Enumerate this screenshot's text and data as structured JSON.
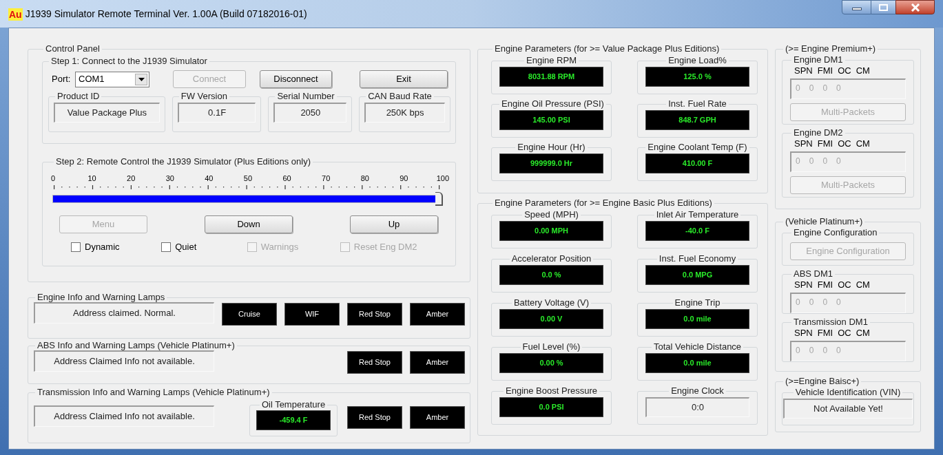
{
  "window": {
    "app_icon": "Au",
    "title": "J1939 Simulator Remote Terminal Ver. 1.00A (Build 07182016-01)"
  },
  "control_panel": {
    "title": "Control Panel",
    "step1": {
      "title": "Step 1: Connect to the J1939 Simulator",
      "port_label": "Port:",
      "port_value": "COM1",
      "buttons": [
        {
          "label": "Connect",
          "disabled": true
        },
        {
          "label": "Disconnect",
          "disabled": false
        },
        {
          "label": "Exit",
          "disabled": false
        }
      ],
      "info": [
        {
          "title": "Product ID",
          "value": "Value Package Plus"
        },
        {
          "title": "FW Version",
          "value": "0.1F"
        },
        {
          "title": "Serial Number",
          "value": "2050"
        },
        {
          "title": "CAN Baud Rate",
          "value": "250K bps"
        }
      ]
    },
    "step2": {
      "title": "Step 2: Remote Control the J1939 Simulator (Plus Editions only)",
      "scale": [
        "0",
        "10",
        "20",
        "30",
        "40",
        "50",
        "60",
        "70",
        "80",
        "90",
        "100"
      ],
      "slider": {
        "level": 1
      },
      "buttons": [
        {
          "label": "Menu",
          "disabled": true
        },
        {
          "label": "Down",
          "disabled": false
        },
        {
          "label": "Up",
          "disabled": false
        }
      ],
      "checkboxes": [
        {
          "label": "Dynamic",
          "checked": false,
          "disabled": false
        },
        {
          "label": "Quiet",
          "checked": false,
          "disabled": false
        },
        {
          "label": "Warnings",
          "checked": false,
          "disabled": true
        },
        {
          "label": "Reset Eng DM2",
          "checked": false,
          "disabled": true
        }
      ]
    }
  },
  "lamp_groups": [
    {
      "title": "Engine Info and Warning Lamps",
      "status": "Address claimed. Normal.",
      "lamps": [
        "Cruise",
        "WIF",
        "Red Stop",
        "Amber"
      ]
    },
    {
      "title": "ABS Info and Warning Lamps (Vehicle Platinum+)",
      "status": "Address Claimed Info not available.",
      "lamps": [
        "Red Stop",
        "Amber"
      ]
    },
    {
      "title": "Transmission Info and Warning Lamps (Vehicle Platinum+)",
      "status": "Address Claimed Info not available.",
      "gauge": {
        "title": "Oil Temperature",
        "value": "-459.4 F"
      },
      "lamps": [
        "Red Stop",
        "Amber"
      ]
    }
  ],
  "value_package_parameters": {
    "title": "Engine Parameters (for >= Value Package Plus Editions)",
    "gauges": [
      {
        "label": "Engine RPM",
        "value": "8031.88 RPM",
        "kind": "display"
      },
      {
        "label": "Engine Load%",
        "value": "125.0 %",
        "kind": "display"
      },
      {
        "label": "Engine Oil Pressure (PSI)",
        "value": "145.00 PSI",
        "kind": "display"
      },
      {
        "label": "Inst. Fuel Rate",
        "value": "848.7 GPH",
        "kind": "display"
      },
      {
        "label": "Engine Hour (Hr)",
        "value": "999999.0 Hr",
        "kind": "display"
      },
      {
        "label": "Engine Coolant Temp (F)",
        "value": "410.00 F",
        "kind": "display"
      }
    ]
  },
  "basic_parameters": {
    "title": "Engine Parameters (for >= Engine Basic Plus Editions)",
    "gauges": [
      {
        "label": "Speed (MPH)",
        "value": "0.00 MPH",
        "kind": "display"
      },
      {
        "label": "Inlet Air Temperature",
        "value": "-40.0 F",
        "kind": "display"
      },
      {
        "label": "Accelerator Position",
        "value": "0.0 %",
        "kind": "display"
      },
      {
        "label": "Inst. Fuel Economy",
        "value": "0.0 MPG",
        "kind": "display"
      },
      {
        "label": "Battery Voltage (V)",
        "value": "0.00 V",
        "kind": "display"
      },
      {
        "label": "Engine Trip",
        "value": "0.0 mile",
        "kind": "display"
      },
      {
        "label": "Fuel Level (%)",
        "value": "0.00 %",
        "kind": "display"
      },
      {
        "label": "Total Vehicle Distance",
        "value": "0.0 mile",
        "kind": "display"
      },
      {
        "label": "Engine Boost Pressure",
        "value": "0.0 PSI",
        "kind": "display"
      },
      {
        "label": "Engine Clock",
        "value": "0:0",
        "kind": "field"
      }
    ]
  },
  "premium": {
    "title": "(>= Engine Premium+)",
    "groups": [
      {
        "title": "Engine DM1",
        "headers": [
          "SPN",
          "FMI",
          "OC",
          "CM"
        ],
        "values": [
          "0",
          "0",
          "0",
          "0"
        ],
        "button": {
          "label": "Multi-Packets",
          "disabled": true
        }
      },
      {
        "title": "Engine DM2",
        "headers": [
          "SPN",
          "FMI",
          "OC",
          "CM"
        ],
        "values": [
          "0",
          "0",
          "0",
          "0"
        ],
        "button": {
          "label": "Multi-Packets",
          "disabled": true
        }
      }
    ]
  },
  "platinum": {
    "title": "(Vehicle Platinum+)",
    "configuration": {
      "title": "Engine Configuration",
      "button": {
        "label": "Engine Configuration",
        "disabled": true
      }
    },
    "groups": [
      {
        "title": "ABS DM1",
        "headers": [
          "SPN",
          "FMI",
          "OC",
          "CM"
        ],
        "values": [
          "0",
          "0",
          "0",
          "0"
        ]
      },
      {
        "title": "Transmission DM1",
        "headers": [
          "SPN",
          "FMI",
          "OC",
          "CM"
        ],
        "values": [
          "0",
          "0",
          "0",
          "0"
        ]
      }
    ]
  },
  "basic": {
    "title": "(>=Engine Baisc+)",
    "vin": {
      "title": "Vehicle Identification (VIN)",
      "value": "Not Available Yet!"
    }
  }
}
